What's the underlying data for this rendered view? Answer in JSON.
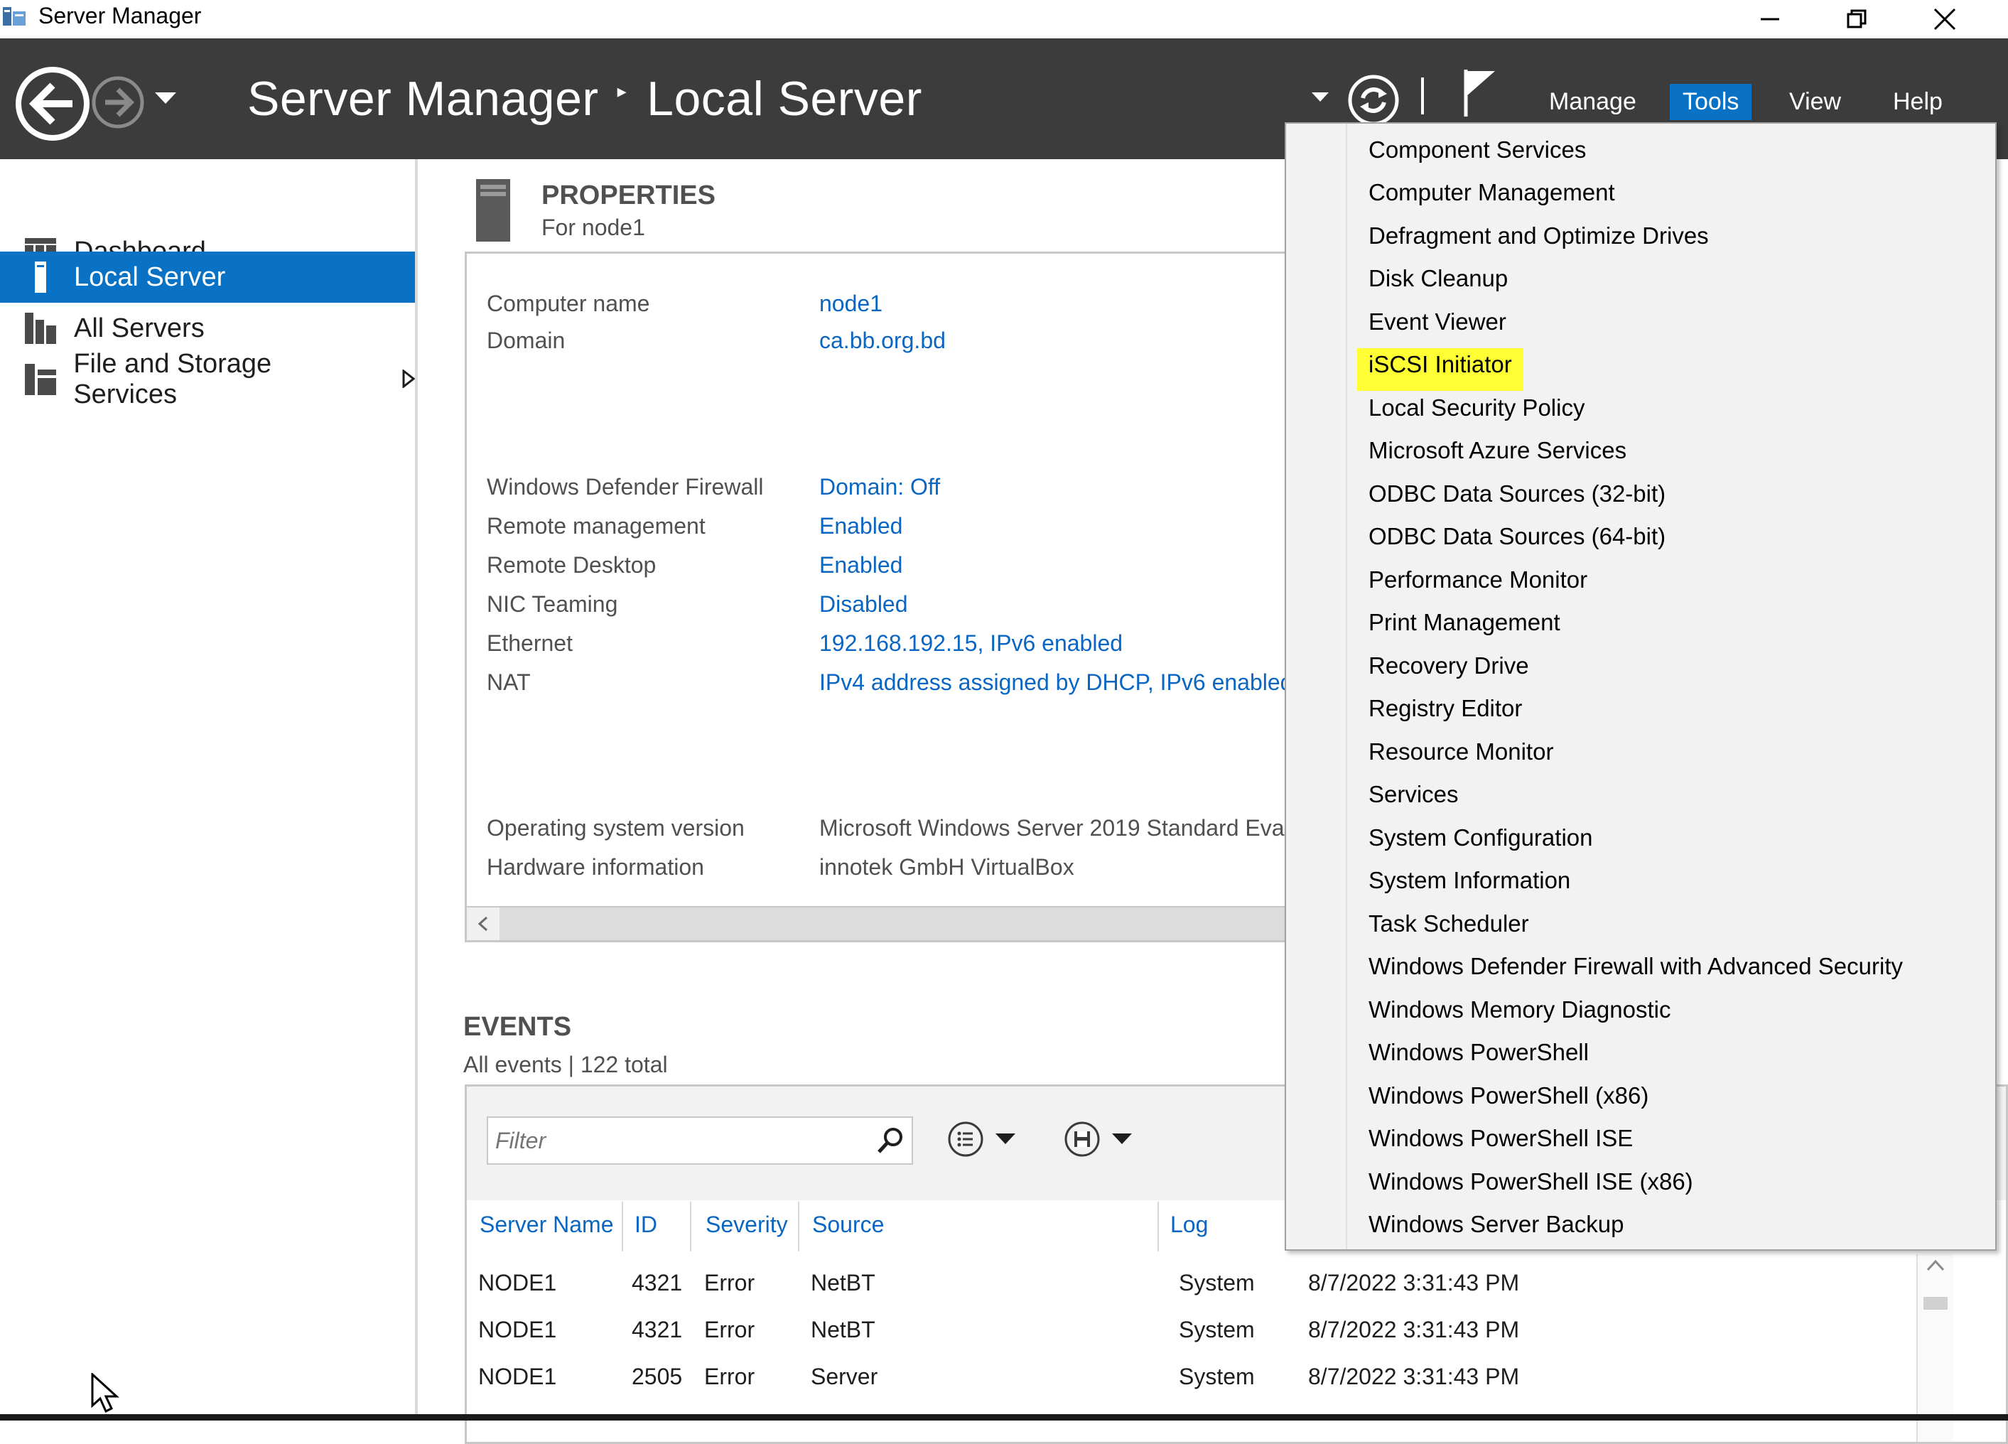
{
  "window": {
    "title": "Server Manager"
  },
  "header": {
    "breadcrumb_root": "Server Manager",
    "breadcrumb_separator": "▸",
    "breadcrumb_current": "Local Server",
    "menus": [
      "Manage",
      "Tools",
      "View",
      "Help"
    ],
    "active_menu": "Tools"
  },
  "sidebar": {
    "items": [
      {
        "label": "Dashboard",
        "icon": "dashboard-icon"
      },
      {
        "label": "Local Server",
        "icon": "local-server-icon",
        "active": true
      },
      {
        "label": "All Servers",
        "icon": "all-servers-icon"
      },
      {
        "label": "File and Storage Services",
        "icon": "file-storage-icon",
        "has_submenu": true
      }
    ]
  },
  "properties": {
    "title": "PROPERTIES",
    "subtitle": "For node1",
    "rows": [
      {
        "label": "Computer name",
        "value": "node1",
        "link": true
      },
      {
        "label": "Domain",
        "value": "ca.bb.org.bd",
        "link": true
      },
      {
        "label": "Windows Defender Firewall",
        "value": "Domain: Off",
        "link": true
      },
      {
        "label": "Remote management",
        "value": "Enabled",
        "link": true
      },
      {
        "label": "Remote Desktop",
        "value": "Enabled",
        "link": true
      },
      {
        "label": "NIC Teaming",
        "value": "Disabled",
        "link": true
      },
      {
        "label": "Ethernet",
        "value": "192.168.192.15, IPv6 enabled",
        "link": true
      },
      {
        "label": "NAT",
        "value": "IPv4 address assigned by DHCP, IPv6 enabled",
        "link": true
      },
      {
        "label": "Operating system version",
        "value": "Microsoft Windows Server 2019 Standard Eva",
        "link": false
      },
      {
        "label": "Hardware information",
        "value": "innotek GmbH VirtualBox",
        "link": false
      }
    ]
  },
  "events": {
    "title": "EVENTS",
    "subtitle": "All events | 122 total",
    "filter_placeholder": "Filter",
    "columns": [
      "Server Name",
      "ID",
      "Severity",
      "Source",
      "Log"
    ],
    "rows": [
      {
        "server": "NODE1",
        "id": "4321",
        "severity": "Error",
        "source": "NetBT",
        "log": "System",
        "date": "8/7/2022 3:31:43 PM"
      },
      {
        "server": "NODE1",
        "id": "4321",
        "severity": "Error",
        "source": "NetBT",
        "log": "System",
        "date": "8/7/2022 3:31:43 PM"
      },
      {
        "server": "NODE1",
        "id": "2505",
        "severity": "Error",
        "source": "Server",
        "log": "System",
        "date": "8/7/2022 3:31:43 PM"
      }
    ]
  },
  "tools_menu": {
    "highlighted": "iSCSI Initiator",
    "items": [
      "Component Services",
      "Computer Management",
      "Defragment and Optimize Drives",
      "Disk Cleanup",
      "Event Viewer",
      "iSCSI Initiator",
      "Local Security Policy",
      "Microsoft Azure Services",
      "ODBC Data Sources (32-bit)",
      "ODBC Data Sources (64-bit)",
      "Performance Monitor",
      "Print Management",
      "Recovery Drive",
      "Registry Editor",
      "Resource Monitor",
      "Services",
      "System Configuration",
      "System Information",
      "Task Scheduler",
      "Windows Defender Firewall with Advanced Security",
      "Windows Memory Diagnostic",
      "Windows PowerShell",
      "Windows PowerShell (x86)",
      "Windows PowerShell ISE",
      "Windows PowerShell ISE (x86)",
      "Windows Server Backup"
    ]
  },
  "colors": {
    "header_bg": "#3c3c3c",
    "accent": "#0a72c4",
    "link": "#0a66c2",
    "highlight": "#ffff33"
  }
}
